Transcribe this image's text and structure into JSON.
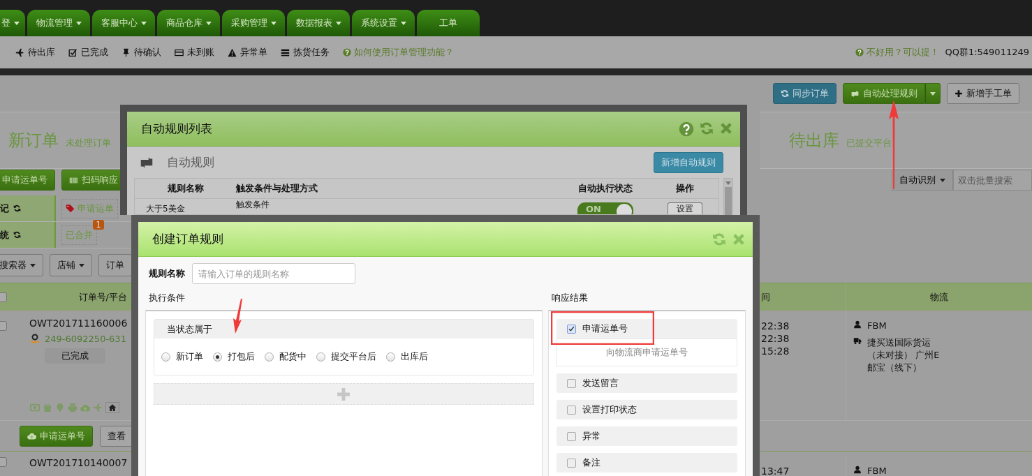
{
  "top_nav": {
    "tabs": [
      {
        "label": "登",
        "dropdown": true
      },
      {
        "label": "物流管理",
        "dropdown": true
      },
      {
        "label": "客服中心",
        "dropdown": true
      },
      {
        "label": "商品仓库",
        "dropdown": true
      },
      {
        "label": "采购管理",
        "dropdown": true
      },
      {
        "label": "数据报表",
        "dropdown": true
      },
      {
        "label": "系统设置",
        "dropdown": true
      },
      {
        "label": "工单",
        "dropdown": false
      }
    ]
  },
  "sub_nav": {
    "items": [
      "待出库",
      "已完成",
      "待确认",
      "未到账",
      "异常单",
      "拣货任务"
    ],
    "help_link": "如何使用订单管理功能？",
    "feedback_link": "不好用？可以提！",
    "qq_group": "QQ群1:549011249"
  },
  "toolbar": {
    "buttons": [
      {
        "label": "同步订单",
        "kind": "primary"
      },
      {
        "label": "自动处理规则",
        "kind": "split"
      },
      {
        "label": "新增手工单",
        "kind": "default"
      }
    ]
  },
  "steps": [
    {
      "title": "新订单",
      "subtitle": "未处理订单"
    },
    {
      "title": "待出库",
      "subtitle": "已提交平台"
    }
  ],
  "action_buttons": [
    "申请运单号",
    "扫码响应"
  ],
  "search": {
    "mode": "自动识别",
    "placeholder": "双击批量搜索"
  },
  "status_filters": [
    {
      "label": "记",
      "tag": "申请运单"
    },
    {
      "label": "统",
      "tag": "已合并",
      "badge": "1"
    }
  ],
  "filter_buttons": [
    "搜索器",
    "店铺",
    "订单"
  ],
  "orders": {
    "all_selected": false,
    "columns": [
      "订单号/平台",
      "间",
      "物流"
    ],
    "rows": [
      {
        "selected": false,
        "order_no": "OWT201711160006",
        "platform_order": "249-6092250-631",
        "status": "已完成",
        "times": [
          "22:38",
          "22:38",
          "15:28"
        ],
        "shipping": [
          "FBM",
          "捷买送国际货运（未对接） 广州E邮宝（线下）"
        ],
        "actions": [
          "申请运单号",
          "查看"
        ]
      },
      {
        "selected": false,
        "order_no": "OWT201710140007",
        "times": [
          "13:47"
        ],
        "shipping": [
          "FBM"
        ]
      }
    ]
  },
  "rules_dialog": {
    "title": "自动规则列表",
    "heading": "自动规则",
    "add_button": "新增自动规则",
    "columns": [
      "规则名称",
      "触发条件与处理方式",
      "自动执行状态",
      "操作"
    ],
    "rows": [
      {
        "name": "大于5美金",
        "trigger": "触发条件",
        "enabled": true,
        "toggle_label": "ON",
        "action": "设置"
      }
    ]
  },
  "create_dialog": {
    "title": "创建订单规则",
    "name_label": "规则名称",
    "name_placeholder": "请输入订单的规则名称",
    "conditions_label": "执行条件",
    "condition": {
      "title": "当状态属于",
      "options": [
        {
          "label": "新订单",
          "selected": false
        },
        {
          "label": "打包后",
          "selected": true
        },
        {
          "label": "配货中",
          "selected": false
        },
        {
          "label": "提交平台后",
          "selected": false
        },
        {
          "label": "出库后",
          "selected": false
        }
      ]
    },
    "results_label": "响应结果",
    "results": [
      {
        "label": "申请运单号",
        "checked": true,
        "description": "向物流商申请运单号"
      },
      {
        "label": "发送留言",
        "checked": false
      },
      {
        "label": "设置打印状态",
        "checked": false
      },
      {
        "label": "异常",
        "checked": false
      },
      {
        "label": "备注",
        "checked": false
      }
    ]
  }
}
